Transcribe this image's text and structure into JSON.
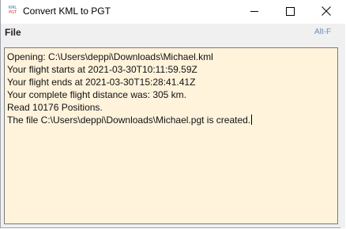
{
  "window": {
    "title": "Convert KML to PGT",
    "icon_name": "kml-pgt-icon",
    "icon_top": "KML",
    "icon_bottom": "PGT"
  },
  "menubar": {
    "file_label": "File",
    "shortcut_label": "Alt-F"
  },
  "log": {
    "lines": [
      "Opening: C:\\Users\\deppi\\Downloads\\Michael.kml",
      "Your flight starts at 2021-03-30T10:11:59.59Z",
      "Your flight ends at 2021-03-30T15:28:41.41Z",
      "Your complete flight distance was: 305 km.",
      "Read 10176 Positions.",
      "The file C:\\Users\\deppi\\Downloads\\Michael.pgt is created."
    ]
  },
  "colors": {
    "text_area_bg": "#fff3dc",
    "shortcut_text": "#6b8fb3"
  }
}
